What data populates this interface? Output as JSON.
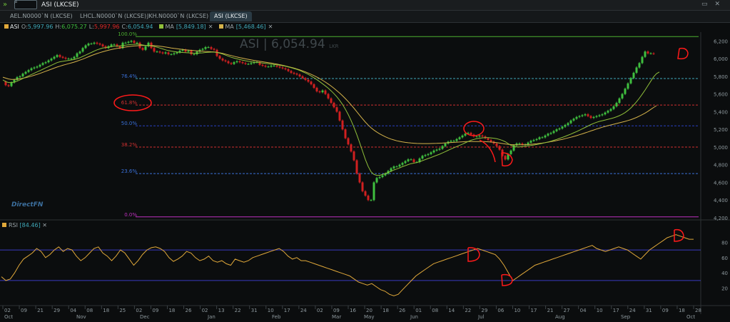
{
  "window": {
    "title": "ASI (LKCSE)",
    "controls": [
      "▭",
      "✕"
    ]
  },
  "tabs": [
    {
      "label": "AEL.N0000`N (LKCSE)",
      "active": false
    },
    {
      "label": "LHCL.N0000`N (LKCSE)",
      "active": false
    },
    {
      "label": "JKH.N0000`N (LKCSE)",
      "active": false
    },
    {
      "label": "ASI (LKCSE)",
      "active": true
    }
  ],
  "legend": {
    "symbol": "ASI",
    "open_label": "O:",
    "open": "5,997.96",
    "high_label": "H:",
    "high": "6,075.27",
    "low_label": "L:",
    "low": "5,997.96",
    "close_label": "C:",
    "close": "6,054.94",
    "ma1_label": "MA",
    "ma1": "[5,849.18]",
    "ma2_label": "MA",
    "ma2": "[5,468.46]"
  },
  "watermark": {
    "text": "ASI | 6,054.94",
    "unit": "LKR"
  },
  "logo": "DirectFN",
  "rsi_label": "RSI",
  "rsi_value": "[84.46]",
  "colors": {
    "background": "#0b0d0e",
    "candle_up": "#3fbf3f",
    "candle_down": "#d02020",
    "ma_fast": "#8fbf3a",
    "ma_slow": "#d4b24a",
    "rsi_line": "#e0a83a",
    "annotation": "#ff1a1a"
  },
  "chart_data": [
    {
      "type": "candlestick",
      "title": "ASI (LKCSE)",
      "ylim": [
        4200,
        6300
      ],
      "y_ticks": [
        "6,200",
        "6,000",
        "5,800",
        "5,600",
        "5,400",
        "5,200",
        "5,000",
        "4,800",
        "4,600",
        "4,400",
        "4,200"
      ],
      "fib_levels": [
        {
          "label": "100.0%",
          "value": 6250,
          "color": "#4caf30"
        },
        {
          "label": "76.4%",
          "value": 5775,
          "color": "#3fa8b8"
        },
        {
          "label": "61.8%",
          "value": 5475,
          "color": "#d03030"
        },
        {
          "label": "50.0%",
          "value": 5240,
          "color": "#2a40c0"
        },
        {
          "label": "38.2%",
          "value": 5000,
          "color": "#d03030"
        },
        {
          "label": "23.6%",
          "value": 4700,
          "color": "#3a70d8"
        },
        {
          "label": "0.0%",
          "value": 4210,
          "color": "#c030c0"
        }
      ],
      "x": [
        0,
        4,
        8,
        12,
        16,
        20,
        24,
        28,
        32,
        36,
        40,
        44,
        48,
        52,
        56,
        60,
        64,
        68,
        72,
        76,
        80,
        84,
        88,
        92,
        96,
        100,
        104,
        108,
        112,
        116,
        120,
        124,
        128,
        132,
        136,
        140,
        144,
        148,
        152,
        156,
        160,
        164,
        168,
        172,
        176,
        180,
        184,
        188,
        192,
        196,
        200,
        204,
        208,
        212,
        216,
        220,
        224,
        228,
        232,
        236,
        240,
        244,
        248,
        252,
        256,
        260,
        264,
        268,
        272,
        276,
        280,
        284,
        288,
        292,
        296,
        300,
        304,
        308,
        312,
        316,
        320,
        324,
        328,
        332,
        336,
        340,
        344,
        348,
        352,
        356,
        360,
        364,
        368,
        372,
        376,
        380,
        384,
        388,
        392,
        396,
        400,
        404,
        408,
        412,
        416,
        420,
        424,
        428,
        432,
        436,
        440,
        444,
        448,
        452,
        456,
        460,
        464,
        468,
        472,
        476,
        480,
        484,
        488,
        492,
        496,
        500,
        504,
        508,
        512,
        516,
        520,
        524,
        528,
        532,
        536,
        540,
        544,
        548,
        552,
        556,
        560,
        564,
        568,
        572,
        576,
        580,
        584,
        588,
        592,
        596,
        600,
        604,
        608,
        612,
        616,
        620,
        624,
        628,
        632,
        636,
        640,
        644,
        648,
        652,
        656,
        660,
        664,
        668,
        672,
        676,
        680,
        684,
        688,
        692,
        696,
        700,
        704,
        708,
        712,
        716,
        720,
        724,
        728,
        732,
        736,
        740,
        744,
        748,
        752,
        756,
        760,
        764,
        768,
        772,
        776,
        780,
        784,
        788,
        792,
        796,
        800,
        804,
        808,
        812,
        816,
        820,
        824,
        828,
        832,
        836,
        840,
        844,
        848,
        852,
        856,
        860,
        864,
        868,
        872,
        876,
        880,
        884,
        888,
        892,
        896,
        900,
        904,
        908,
        912,
        916,
        920,
        924,
        928,
        932,
        936,
        940,
        944,
        948,
        952
      ],
      "close": [
        5740,
        5700,
        5690,
        5730,
        5760,
        5790,
        5800,
        5830,
        5850,
        5870,
        5890,
        5900,
        5910,
        5930,
        5950,
        5960,
        5980,
        6000,
        6020,
        6040,
        6020,
        6010,
        6000,
        6000,
        6000,
        6020,
        6060,
        6080,
        6120,
        6150,
        6170,
        6170,
        6180,
        6170,
        6160,
        6140,
        6120,
        6140,
        6160,
        6160,
        6140,
        6120,
        6180,
        6180,
        6190,
        6200,
        6180,
        6180,
        6120,
        6100,
        6140,
        6180,
        6120,
        6080,
        6080,
        6070,
        6060,
        6070,
        6050,
        6050,
        6060,
        6070,
        6090,
        6100,
        6080,
        6090,
        6050,
        6050,
        6080,
        6100,
        6110,
        6130,
        6130,
        6110,
        6100,
        6030,
        6000,
        5980,
        5970,
        5950,
        5940,
        5960,
        5970,
        5960,
        5950,
        5940,
        5940,
        5950,
        5960,
        5960,
        5930,
        5920,
        5910,
        5910,
        5920,
        5920,
        5910,
        5900,
        5890,
        5880,
        5860,
        5840,
        5830,
        5820,
        5800,
        5780,
        5760,
        5740,
        5710,
        5670,
        5630,
        5620,
        5640,
        5600,
        5550,
        5500,
        5450,
        5400,
        5300,
        5200,
        5100,
        5030,
        4950,
        4850,
        4700,
        4600,
        4500,
        4450,
        4400,
        4400,
        4600,
        4650,
        4660,
        4680,
        4700,
        4730,
        4760,
        4780,
        4780,
        4800,
        4820,
        4840,
        4860,
        4860,
        4830,
        4830,
        4870,
        4900,
        4910,
        4920,
        4940,
        4960,
        4970,
        4980,
        5010,
        5040,
        5060,
        5070,
        5070,
        5090,
        5110,
        5130,
        5150,
        5160,
        5140,
        5120,
        5120,
        5130,
        5120,
        5100,
        5080,
        5060,
        5040,
        5010,
        4970,
        4900,
        4860,
        4920,
        4960,
        5020,
        5040,
        5040,
        5030,
        5030,
        5050,
        5070,
        5080,
        5090,
        5110,
        5110,
        5130,
        5150,
        5160,
        5180,
        5200,
        5210,
        5230,
        5250,
        5270,
        5300,
        5320,
        5340,
        5350,
        5360,
        5370,
        5350,
        5330,
        5340,
        5350,
        5360,
        5370,
        5390,
        5410,
        5430,
        5460,
        5500,
        5550,
        5600,
        5660,
        5720,
        5780,
        5840,
        5900,
        5950,
        6020,
        6080,
        6060,
        6060,
        6055
      ],
      "ma_fast": [
        5760,
        5740,
        5730,
        5730,
        5735,
        5745,
        5760,
        5775,
        5790,
        5805,
        5820,
        5835,
        5850,
        5865,
        5880,
        5895,
        5910,
        5925,
        5940,
        5955,
        5965,
        5970,
        5975,
        5980,
        5985,
        5990,
        6000,
        6010,
        6025,
        6040,
        6055,
        6070,
        6085,
        6100,
        6110,
        6120,
        6125,
        6130,
        6135,
        6140,
        6142,
        6144,
        6148,
        6152,
        6156,
        6160,
        6162,
        6164,
        6160,
        6155,
        6150,
        6148,
        6144,
        6138,
        6130,
        6120,
        6110,
        6100,
        6092,
        6085,
        6080,
        6075,
        6072,
        6070,
        6068,
        6066,
        6064,
        6062,
        6062,
        6064,
        6066,
        6070,
        6072,
        6074,
        6074,
        6070,
        6062,
        6052,
        6040,
        6028,
        6016,
        6006,
        5998,
        5990,
        5983,
        5976,
        5970,
        5965,
        5960,
        5958,
        5955,
        5950,
        5946,
        5942,
        5938,
        5934,
        5930,
        5925,
        5920,
        5914,
        5906,
        5898,
        5888,
        5878,
        5866,
        5852,
        5838,
        5822,
        5804,
        5784,
        5762,
        5740,
        5716,
        5692,
        5666,
        5636,
        5604,
        5568,
        5528,
        5482,
        5428,
        5368,
        5300,
        5224,
        5140,
        5050,
        4955,
        4860,
        4780,
        4720,
        4690,
        4680,
        4680,
        4690,
        4700,
        4712,
        4726,
        4740,
        4752,
        4764,
        4778,
        4790,
        4802,
        4812,
        4818,
        4824,
        4834,
        4846,
        4858,
        4870,
        4882,
        4895,
        4907,
        4919,
        4933,
        4948,
        4963,
        4978,
        4992,
        5005,
        5019,
        5033,
        5048,
        5063,
        5076,
        5086,
        5094,
        5100,
        5104,
        5106,
        5106,
        5104,
        5100,
        5094,
        5086,
        5075,
        5060,
        5040,
        5020,
        5008,
        5002,
        5002,
        5006,
        5010,
        5014,
        5018,
        5023,
        5029,
        5035,
        5042,
        5050,
        5058,
        5066,
        5076,
        5086,
        5097,
        5109,
        5121,
        5134,
        5147,
        5161,
        5175,
        5190,
        5206,
        5222,
        5238,
        5254,
        5268,
        5280,
        5290,
        5298,
        5306,
        5314,
        5322,
        5331,
        5342,
        5355,
        5370,
        5390,
        5414,
        5442,
        5475,
        5512,
        5553,
        5598,
        5645,
        5695,
        5745,
        5795,
        5830,
        5849
      ],
      "ma_slow": [
        5790,
        5780,
        5770,
        5765,
        5765,
        5768,
        5772,
        5778,
        5785,
        5793,
        5802,
        5812,
        5822,
        5833,
        5845,
        5857,
        5869,
        5881,
        5893,
        5905,
        5915,
        5925,
        5934,
        5943,
        5952,
        5961,
        5972,
        5983,
        5995,
        6008,
        6021,
        6034,
        6046,
        6058,
        6068,
        6078,
        6087,
        6095,
        6103,
        6110,
        6116,
        6121,
        6126,
        6131,
        6136,
        6140,
        6143,
        6146,
        6148,
        6149,
        6150,
        6150,
        6149,
        6147,
        6144,
        6140,
        6136,
        6131,
        6126,
        6121,
        6116,
        6112,
        6108,
        6104,
        6100,
        6097,
        6094,
        6091,
        6088,
        6086,
        6084,
        6082,
        6080,
        6078,
        6076,
        6072,
        6066,
        6059,
        6051,
        6043,
        6035,
        6027,
        6019,
        6012,
        6005,
        5998,
        5992,
        5986,
        5980,
        5975,
        5970,
        5965,
        5960,
        5955,
        5950,
        5944,
        5938,
        5932,
        5925,
        5918,
        5910,
        5902,
        5893,
        5883,
        5873,
        5862,
        5850,
        5837,
        5823,
        5808,
        5792,
        5774,
        5755,
        5735,
        5713,
        5690,
        5665,
        5638,
        5610,
        5580,
        5548,
        5514,
        5478,
        5440,
        5400,
        5360,
        5320,
        5282,
        5248,
        5218,
        5192,
        5170,
        5150,
        5132,
        5116,
        5102,
        5090,
        5080,
        5071,
        5064,
        5058,
        5053,
        5049,
        5046,
        5043,
        5041,
        5040,
        5039,
        5039,
        5039,
        5040,
        5041,
        5042,
        5043,
        5045,
        5047,
        5049,
        5051,
        5053,
        5055,
        5057,
        5059,
        5061,
        5062,
        5063,
        5063,
        5063,
        5063,
        5062,
        5061,
        5059,
        5057,
        5054,
        5050,
        5045,
        5040,
        5035,
        5031,
        5028,
        5026,
        5025,
        5025,
        5026,
        5027,
        5029,
        5031,
        5034,
        5037,
        5041,
        5045,
        5050,
        5055,
        5061,
        5067,
        5073,
        5080,
        5087,
        5095,
        5103,
        5111,
        5120,
        5129,
        5139,
        5149,
        5160,
        5171,
        5182,
        5193,
        5204,
        5214,
        5224,
        5233,
        5242,
        5250,
        5258,
        5266,
        5274,
        5282,
        5290,
        5300,
        5310,
        5322,
        5335,
        5350,
        5366,
        5384,
        5404,
        5426,
        5448,
        5468
      ]
    },
    {
      "type": "line",
      "title": "RSI",
      "ylim": [
        0,
        100
      ],
      "y_ticks": [
        "80",
        "60",
        "40",
        "20"
      ],
      "bands": [
        70,
        30
      ],
      "x_labels": [
        "02",
        "09",
        "21",
        "29",
        "04",
        "Nov",
        "08",
        "18",
        "25",
        "02",
        "Dec",
        "09",
        "18",
        "26",
        "02",
        "Jan",
        "13",
        "22",
        "31",
        "Feb",
        "10",
        "17",
        "24",
        "02",
        "Mar",
        "09",
        "16",
        "20",
        "May",
        "18",
        "26",
        "01",
        "Jun",
        "08",
        "14",
        "22",
        "29",
        "Jul",
        "06",
        "10",
        "17",
        "21",
        "27",
        "04",
        "Aug",
        "10",
        "17",
        "24",
        "31",
        "Sep",
        "09",
        "18",
        "28",
        "Oct"
      ],
      "values": [
        35,
        30,
        32,
        40,
        50,
        58,
        62,
        66,
        72,
        68,
        60,
        64,
        70,
        74,
        68,
        72,
        70,
        62,
        56,
        60,
        66,
        72,
        74,
        66,
        62,
        56,
        62,
        70,
        66,
        58,
        50,
        56,
        64,
        70,
        73,
        74,
        72,
        68,
        60,
        55,
        58,
        62,
        68,
        66,
        60,
        56,
        58,
        62,
        56,
        54,
        56,
        52,
        50,
        58,
        56,
        54,
        56,
        60,
        62,
        64,
        66,
        68,
        70,
        72,
        68,
        62,
        58,
        60,
        56,
        56,
        54,
        52,
        50,
        48,
        46,
        44,
        42,
        40,
        38,
        36,
        32,
        28,
        26,
        24,
        26,
        22,
        18,
        16,
        12,
        10,
        12,
        18,
        24,
        30,
        36,
        40,
        44,
        48,
        52,
        54,
        56,
        58,
        60,
        62,
        64,
        66,
        68,
        70,
        72,
        70,
        68,
        66,
        64,
        58,
        50,
        40,
        30,
        34,
        38,
        42,
        46,
        50,
        52,
        54,
        56,
        58,
        60,
        62,
        64,
        66,
        68,
        70,
        72,
        74,
        76,
        72,
        70,
        68,
        70,
        72,
        74,
        72,
        70,
        66,
        62,
        58,
        64,
        70,
        74,
        78,
        82,
        86,
        88,
        90,
        88,
        86,
        84,
        84
      ]
    }
  ],
  "x_axis": {
    "day_labels": [
      "02",
      "09",
      "21",
      "29",
      "04",
      "08",
      "18",
      "25",
      "02",
      "09",
      "18",
      "26",
      "02",
      "13",
      "22",
      "31",
      "10",
      "17",
      "24",
      "02",
      "09",
      "16",
      "20",
      "18",
      "26",
      "01",
      "08",
      "14",
      "22",
      "29",
      "06",
      "10",
      "17",
      "21",
      "27",
      "04",
      "10",
      "17",
      "24",
      "31",
      "09",
      "18",
      "28"
    ],
    "month_labels": [
      "Oct",
      "Nov",
      "Dec",
      "Jan",
      "Feb",
      "Mar",
      "May",
      "Jun",
      "Jul",
      "Aug",
      "Sep",
      "Oct"
    ]
  }
}
